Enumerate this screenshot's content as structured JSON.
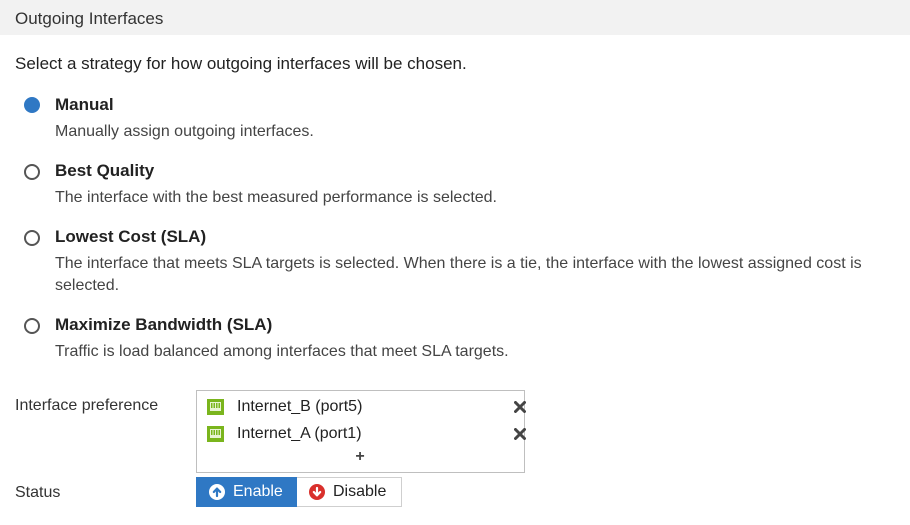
{
  "section": {
    "title": "Outgoing Interfaces"
  },
  "intro": "Select a strategy for how outgoing interfaces will be chosen.",
  "options": [
    {
      "title": "Manual",
      "description": "Manually assign outgoing interfaces.",
      "selected": true
    },
    {
      "title": "Best Quality",
      "description": "The interface with the best measured performance is selected.",
      "selected": false
    },
    {
      "title": "Lowest Cost (SLA)",
      "description": "The interface that meets SLA targets is selected. When there is a tie, the interface with the lowest assigned cost is selected.",
      "selected": false
    },
    {
      "title": "Maximize Bandwidth (SLA)",
      "description": "Traffic is load balanced among interfaces that meet SLA targets.",
      "selected": false
    }
  ],
  "interface_preference": {
    "label": "Interface preference",
    "items": [
      {
        "name": "Internet_B (port5)",
        "icon": "ethernet-port-icon"
      },
      {
        "name": "Internet_A (port1)",
        "icon": "ethernet-port-icon"
      }
    ],
    "add_symbol": "+"
  },
  "status": {
    "label": "Status",
    "enable_label": "Enable",
    "disable_label": "Disable",
    "value": "Enable"
  },
  "colors": {
    "accent": "#2f78c4",
    "header_bg": "#f2f2f2",
    "port_icon": "#7ab51d",
    "disable_icon": "#d9302c"
  }
}
